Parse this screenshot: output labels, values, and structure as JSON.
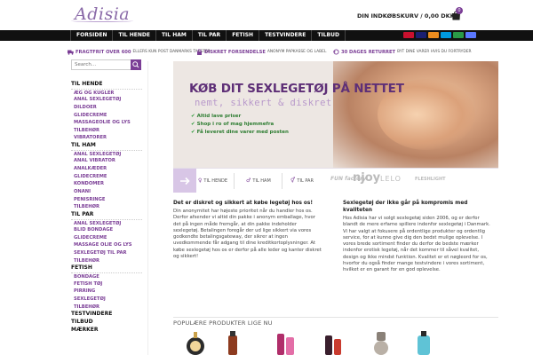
{
  "header": {
    "logo": "Adisia",
    "cart_text": "DIN INDKØBSKURV / 0,00 DKK",
    "cart_count": "0"
  },
  "nav": {
    "items": [
      "FORSIDEN",
      "TIL HENDE",
      "TIL HAM",
      "TIL PAR",
      "FETISH",
      "TESTVINDERE",
      "TILBUD"
    ]
  },
  "infobar": {
    "free_shipping": {
      "bold": "FRAGTFRIT OVER 600",
      "sub": "ELLERS KUN POST DANMARKS TAKSTER"
    },
    "discreet": {
      "bold": "DISKRET FORSENDELSE",
      "sub": "ANONYM PAPKASSE OG LABEL"
    },
    "returns": {
      "bold": "30 DAGES RETURRET",
      "sub": "BYT DINE VARER HVIS DU FORTRYDER"
    }
  },
  "search": {
    "placeholder": "Search..."
  },
  "sidebar": {
    "til_hende": {
      "label": "TIL HENDE",
      "items": [
        "ÆG OG KUGLER",
        "ANAL SEXLEGETØJ",
        "DILDOER",
        "GLIDECREME",
        "MASSAGEOLIE OG LYS",
        "TILBEHØR",
        "VIBRATORER"
      ]
    },
    "til_ham": {
      "label": "TIL HAM",
      "items": [
        "ANAL SEXLEGETØJ",
        "ANAL VIBRATOR",
        "ANALKÆDER",
        "GLIDECREME",
        "KONDOMER",
        "ONANI",
        "PENISRINGE",
        "TILBEHØR"
      ]
    },
    "til_par": {
      "label": "TIL PAR",
      "items": [
        "ANAL SEXLEGETØJ",
        "BLID BONDAGE",
        "GLIDECREME",
        "MASSAGE OLIE OG LYS",
        "SEXLEGETØJ TIL PAR",
        "TILBEHØR"
      ]
    },
    "fetish": {
      "label": "FETISH",
      "items": [
        "BONDAGE",
        "FETISH TØJ",
        "PIRRING",
        "SEXLEGETØJ",
        "TILBEHØR"
      ]
    },
    "testvindere": "TESTVINDERE",
    "tilbud": "TILBUD",
    "maerker": "MÆRKER"
  },
  "banner": {
    "title": "KØB DIT SEXLEGETØJ PÅ NETTET",
    "subtitle": "nemt, sikkert & diskret",
    "bullets": [
      "Altid lave priser",
      "Shop i ro of mag hjemmefra",
      "Få leveret dine varer med posten"
    ],
    "links": [
      "TIL HENDE",
      "TIL HAM",
      "TIL PAR"
    ],
    "brands": [
      "FUN factory",
      "njoy",
      "LELO",
      "FLESHLIGHT"
    ]
  },
  "col_left": {
    "heading": "Det er diskret og sikkert at købe legetøj hos os!",
    "body": "Din anonymitet har højeste prioritet når du handler hos os. Derfor afsender vi altid din pakke i anonym emballage, hvor det på ingen måde fremgår, at din pakke indeholder sexlegetøj. Betalingen foregår der ud lige sikkert via vores godkendte betalingsgateway, der sikrer at ingen uvedkommende får adgang til dine kreditkortoplysninger. At købe sexlegetøj hos os er derfor på alle leder og kanter diskret og sikkert!"
  },
  "col_right": {
    "heading": "Sexlegetøj der ikke går på kompromis med kvaliteten",
    "body": "Hos Adisia har vi solgt sexlegetøj siden 2006, og er derfor blandt de mere erfarne spillere indenfor sexlegetøj i Danmark. Vi har valgt at fokusere på ordentlige produkter og ordentlig service, for at kunne give dig den bedst mulige oplevelse. I vores brede sortiment finder du derfor de bedste mærker indenfor erotisk legetøj, når det kommer til såvel kvalitet, design og ikke mindst funktion. Kvalitet er et nøgleord for os, hvorfor du også finder mange testvindere i vores sortiment, hvilket er en garant for en god oplevelse."
  },
  "popular": {
    "title": "POPULÆRE PRODUKTER LIGE NU"
  },
  "colors": {
    "accent": "#7b3e96",
    "nav_bg": "#111111",
    "banner_bg": "#ede7e3"
  }
}
